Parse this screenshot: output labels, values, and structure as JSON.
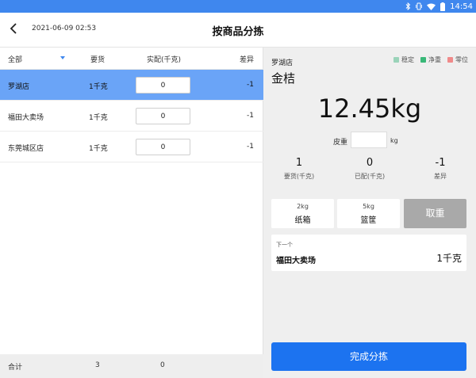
{
  "status_bar": {
    "time": "14:54"
  },
  "header": {
    "datetime": "2021-06-09 02:53",
    "title": "按商品分拣"
  },
  "table": {
    "columns": {
      "store": "全部",
      "required": "要货",
      "actual": "实配(千克)",
      "diff": "差异"
    },
    "rows": [
      {
        "store": "罗湖店",
        "required": "1千克",
        "actual": "0",
        "diff": "-1",
        "selected": true
      },
      {
        "store": "福田大卖场",
        "required": "1千克",
        "actual": "0",
        "diff": "-1",
        "selected": false
      },
      {
        "store": "东莞城区店",
        "required": "1千克",
        "actual": "0",
        "diff": "-1",
        "selected": false
      }
    ],
    "footer": {
      "label": "合计",
      "required_total": "3",
      "actual_total": "0"
    }
  },
  "detail": {
    "store": "罗湖店",
    "product": "金桔",
    "legend": [
      {
        "label": "稳定",
        "color": "#9ad3b9"
      },
      {
        "label": "净重",
        "color": "#39b878"
      },
      {
        "label": "零位",
        "color": "#f08a8a"
      }
    ],
    "weight": "12.45kg",
    "tare_label": "皮重",
    "tare_value": "",
    "tare_unit": "kg",
    "stats": [
      {
        "value": "1",
        "label": "要货(千克)"
      },
      {
        "value": "0",
        "label": "已配(千克)"
      },
      {
        "value": "-1",
        "label": "差异"
      }
    ],
    "tare_buttons": [
      {
        "weight": "2kg",
        "name": "纸箱"
      },
      {
        "weight": "5kg",
        "name": "篮筐"
      }
    ],
    "clear_tare": "取重",
    "next": {
      "label": "下一个",
      "store": "福田大卖场",
      "qty": "1千克"
    },
    "finish": "完成分拣"
  }
}
